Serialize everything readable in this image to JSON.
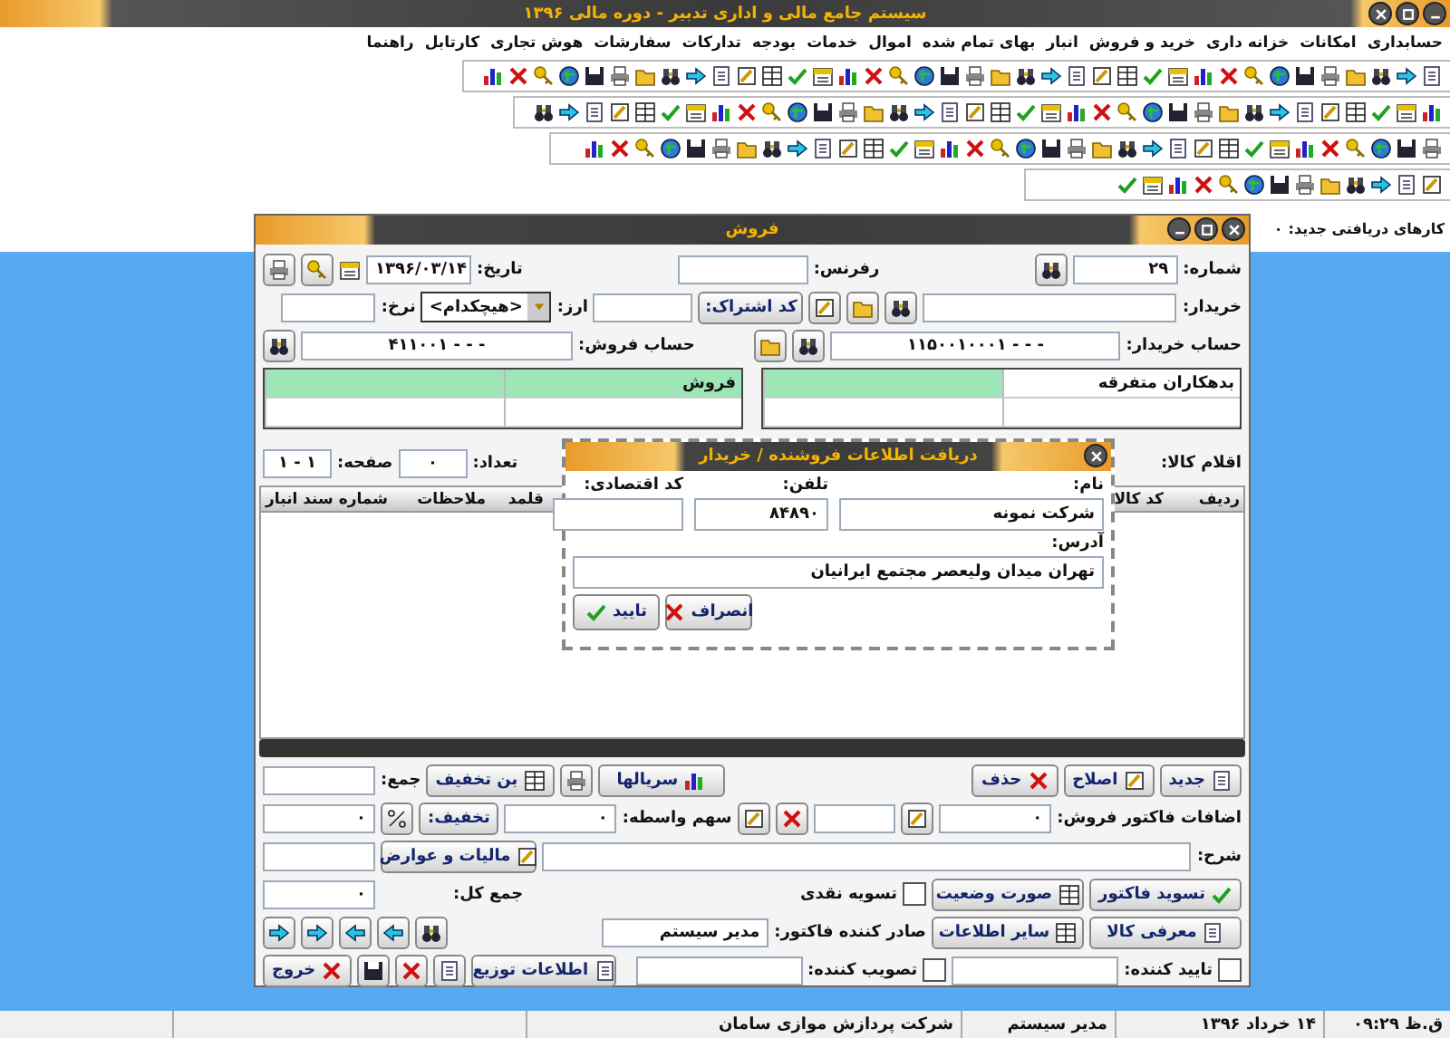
{
  "app": {
    "title": "سیستم جامع مالی و اداری تدبیر - دوره مالی ۱۳۹۶"
  },
  "menu": [
    {
      "label": "حسابداری"
    },
    {
      "label": "امکانات"
    },
    {
      "label": "خزانه داری"
    },
    {
      "label": "خرید و فروش"
    },
    {
      "label": "انبار"
    },
    {
      "label": "بهای تمام شده"
    },
    {
      "label": "اموال"
    },
    {
      "label": "خدمات"
    },
    {
      "label": "بودجه"
    },
    {
      "label": "تدارکات"
    },
    {
      "label": "سفارشات"
    },
    {
      "label": "هوش تجاری"
    },
    {
      "label": "کارتابل"
    },
    {
      "label": "راهنما"
    }
  ],
  "inbox": {
    "label": "کارهای دریافتی جدید:",
    "count": "۰"
  },
  "sales": {
    "title": "فروش",
    "number": {
      "label": "شماره:",
      "value": "۲۹"
    },
    "reference": {
      "label": "رفرنس:"
    },
    "date": {
      "label": "تاریخ:",
      "value": "۱۳۹۶/۰۳/۱۴"
    },
    "buyer": {
      "label": "خریدار:"
    },
    "subscription_button": "کد اشتراک:",
    "currency": {
      "label": "ارز:",
      "value": "<هیچکدام>"
    },
    "rate": {
      "label": "نرخ:"
    },
    "buyer_account": {
      "label": "حساب خریدار:",
      "value": "۱۱۵۰۰۱۰۰۰۱ - - -",
      "description": "بدهکاران متفرقه"
    },
    "sales_account": {
      "label": "حساب فروش:",
      "value": "۴۱۱۰۰۱ - - -",
      "description": "فروش"
    },
    "items": {
      "label": "اقلام کالا:",
      "count_label": "تعداد:",
      "count": "۰",
      "page_label": "صفحه:",
      "page": "۱ - ۱"
    },
    "columns": [
      "ردیف",
      "کد کالا",
      "قلمد",
      "ملاحظات",
      "شماره سند انبار"
    ],
    "row_buttons": [
      "جدید",
      "اصلاح",
      "حذف"
    ],
    "serials_button": "سریالها",
    "discount_voucher_button": "بن تخفیف",
    "total": {
      "label": "جمع:"
    },
    "additions": {
      "label": "اضافات فاکتور فروش:",
      "value": "۰"
    },
    "broker_share": {
      "label": "سهم واسطه:",
      "value": "۰"
    },
    "discount": {
      "button": "تخفیف:",
      "value": "۰"
    },
    "description": {
      "label": "شرح:"
    },
    "tax_button": "مالیات و عوارض",
    "grand_total": {
      "label": "جمع کل:",
      "value": "۰"
    },
    "draft_button": "تسوید فاکتور",
    "statement_button": "صورت وضعیت",
    "cash_settlement": {
      "label": "تسویه نقدی",
      "checked": false
    },
    "product_button": "معرفی کالا",
    "other_info_button": "سایر اطلاعات",
    "issuer": {
      "label": "صادر کننده فاکتور:",
      "value": "مدیر سیستم"
    },
    "approver": {
      "label": "تایید کننده:",
      "checked": false
    },
    "ratifier": {
      "label": "تصویب کننده:",
      "checked": false
    },
    "distribution_button": "اطلاعات توزیع",
    "exit_button": "خروج"
  },
  "dialog": {
    "title": "دریافت اطلاعات فروشنده / خریدار",
    "name": {
      "label": "نام:",
      "value": "شرکت نمونه"
    },
    "phone": {
      "label": "تلفن:",
      "value": "۸۴۸۹۰"
    },
    "economic_code": {
      "label": "کد اقتصادی:"
    },
    "address": {
      "label": "آدرس:",
      "value": "تهران میدان ولیعصر مجتمع ایرانیان"
    },
    "ok_button": "تایید",
    "cancel_button": "انصراف"
  },
  "status_bar": [
    "ق.ظ ۰۹:۲۹",
    "۱۴ خرداد ۱۳۹۶",
    "مدیر سیستم",
    "شرکت پردازش موازی سامان"
  ]
}
